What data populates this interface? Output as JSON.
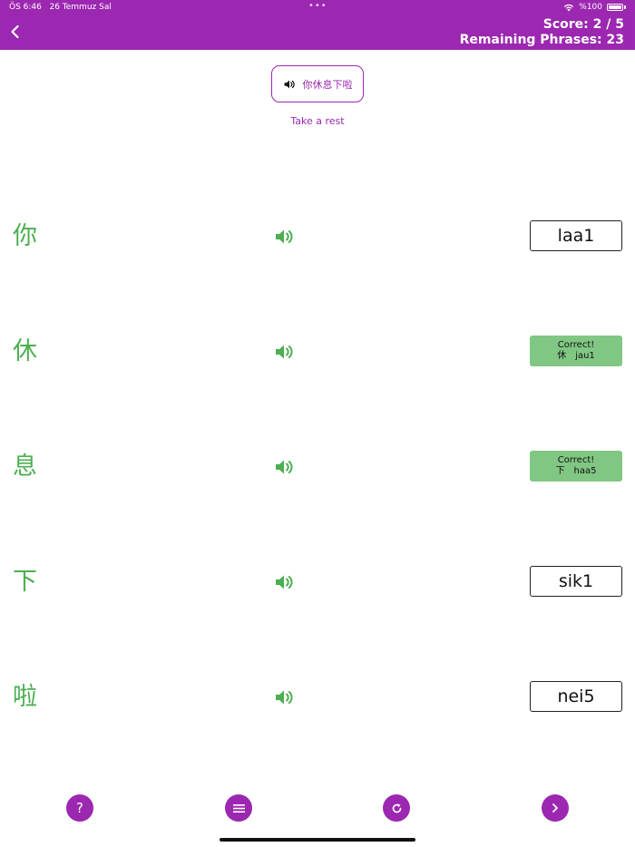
{
  "status_bar": {
    "time": "ÖS 6:46",
    "date": "26 Temmuz Sal",
    "battery": "%100"
  },
  "header": {
    "score": "Score: 2 / 5",
    "remaining": "Remaining Phrases: 23",
    "accent_color": "#9c27b0"
  },
  "phrase": {
    "text": "你休息下啦",
    "translation": "Take a rest"
  },
  "rows": [
    {
      "char": "你",
      "answer": "laa1",
      "state": "button"
    },
    {
      "char": "休",
      "result": "Correct!",
      "result_char": "休",
      "result_romanization": "jau1",
      "state": "correct"
    },
    {
      "char": "息",
      "result": "Correct!",
      "result_char": "下",
      "result_romanization": "haa5",
      "state": "correct"
    },
    {
      "char": "下",
      "answer": "sik1",
      "state": "button"
    },
    {
      "char": "啦",
      "answer": "nei5",
      "state": "button"
    }
  ],
  "colors": {
    "char_green": "#4caf50",
    "correct_bg": "#81c784"
  },
  "toolbar": {
    "help_label": "?",
    "icons": [
      "help-icon",
      "menu-icon",
      "refresh-icon",
      "chevron-right-icon"
    ]
  }
}
